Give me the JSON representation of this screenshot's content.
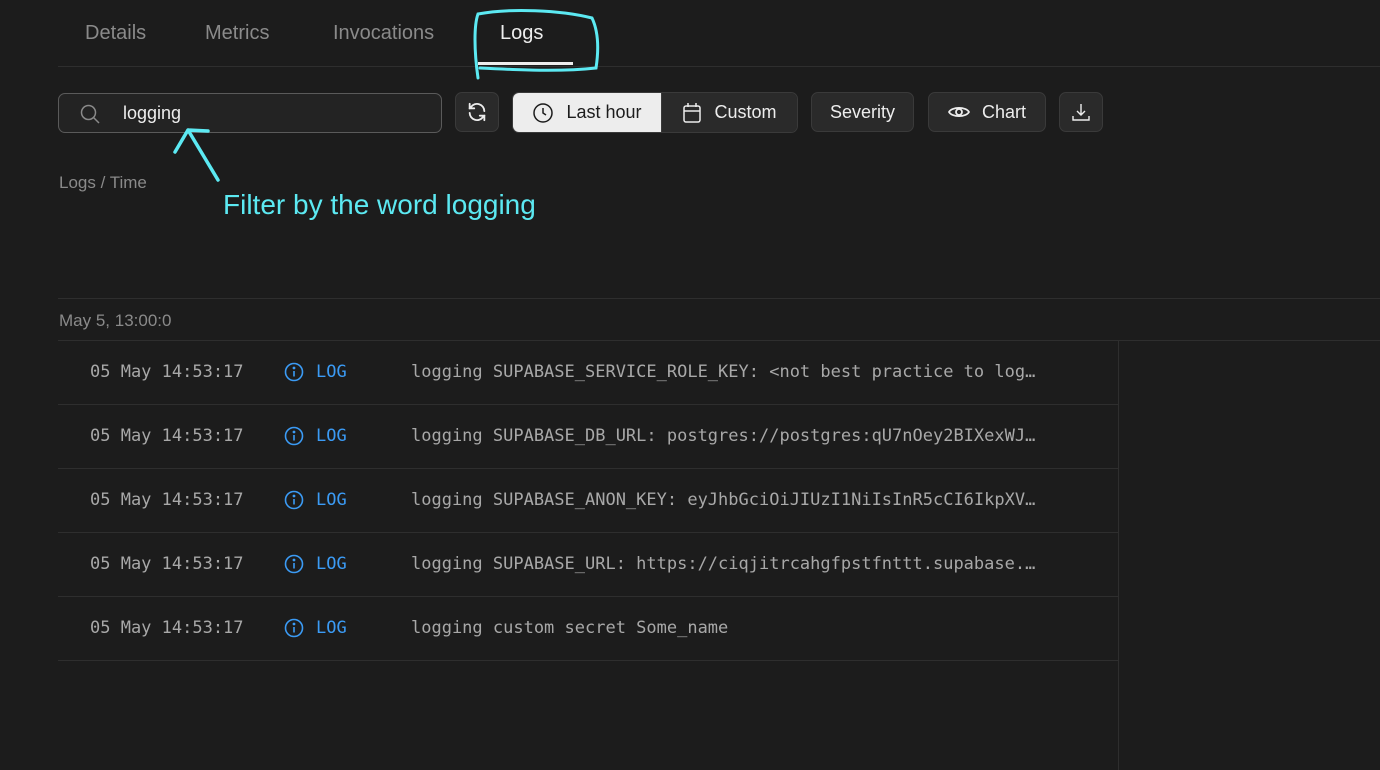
{
  "tabs": [
    {
      "label": "Details"
    },
    {
      "label": "Metrics"
    },
    {
      "label": "Invocations"
    },
    {
      "label": "Logs",
      "active": true
    }
  ],
  "toolbar": {
    "search_value": "logging",
    "refresh_icon": "refresh-icon",
    "time_range": {
      "options": [
        {
          "label": "Last hour",
          "icon": "clock-icon",
          "selected": true
        },
        {
          "label": "Custom",
          "icon": "calendar-icon"
        }
      ]
    },
    "severity_label": "Severity",
    "chart_label": "Chart",
    "download_icon": "download-icon"
  },
  "chart_area": {
    "title": "Logs / Time",
    "time_label": "May 5, 13:00:0"
  },
  "logs": [
    {
      "timestamp": "05 May 14:53:17",
      "level": "LOG",
      "message": "logging SUPABASE_SERVICE_ROLE_KEY: <not best practice to log…"
    },
    {
      "timestamp": "05 May 14:53:17",
      "level": "LOG",
      "message": "logging SUPABASE_DB_URL: postgres://postgres:qU7nOey2BIXexWJ…"
    },
    {
      "timestamp": "05 May 14:53:17",
      "level": "LOG",
      "message": "logging SUPABASE_ANON_KEY: eyJhbGciOiJIUzI1NiIsInR5cCI6IkpXV…"
    },
    {
      "timestamp": "05 May 14:53:17",
      "level": "LOG",
      "message": "logging SUPABASE_URL: https://ciqjitrcahgfpstfnttt.supabase.…"
    },
    {
      "timestamp": "05 May 14:53:17",
      "level": "LOG",
      "message": "logging custom secret Some_name"
    }
  ],
  "annotation": {
    "text": "Filter by the word logging",
    "color": "#5ce9f2"
  },
  "colors": {
    "background": "#1c1c1c",
    "log_level": "#3b9bf5"
  }
}
